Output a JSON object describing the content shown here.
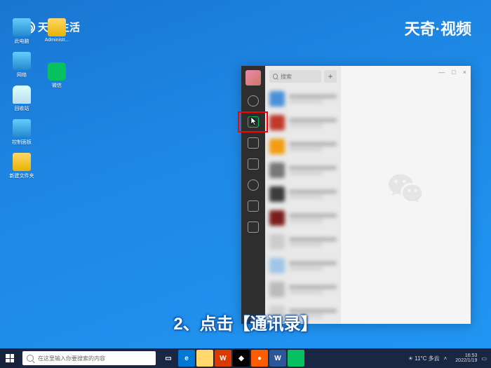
{
  "watermark": {
    "left": "天奇生活",
    "right": "天奇·视频"
  },
  "caption": "2、点击【通讯录】",
  "desktop_icons": {
    "col1": [
      {
        "label": "此电脑"
      },
      {
        "label": "网络"
      },
      {
        "label": "回收站"
      },
      {
        "label": "控制面板"
      },
      {
        "label": "新建文件夹"
      }
    ],
    "col2": [
      {
        "label": "Administr..."
      },
      {
        "label": "微信"
      }
    ]
  },
  "taskbar": {
    "search_placeholder": "在这里输入你要搜索的内容",
    "weather": "11°C 多云",
    "time": "16:53",
    "date": "2022/1/19"
  },
  "app": {
    "search_placeholder": "搜索",
    "add_label": "+",
    "window_controls": {
      "min": "—",
      "max": "□",
      "close": "×"
    },
    "sidebar_icons": [
      "chat",
      "contacts",
      "favorites",
      "files",
      "moments",
      "mini",
      "phone",
      "settings"
    ],
    "chat_colors": [
      "#4a90d9",
      "#c0392b",
      "#f39c12",
      "#777",
      "#3b3b3b",
      "#7a1d1d",
      "#ccc",
      "#a0c4e8",
      "#bbb",
      "#d0d0d0"
    ]
  }
}
